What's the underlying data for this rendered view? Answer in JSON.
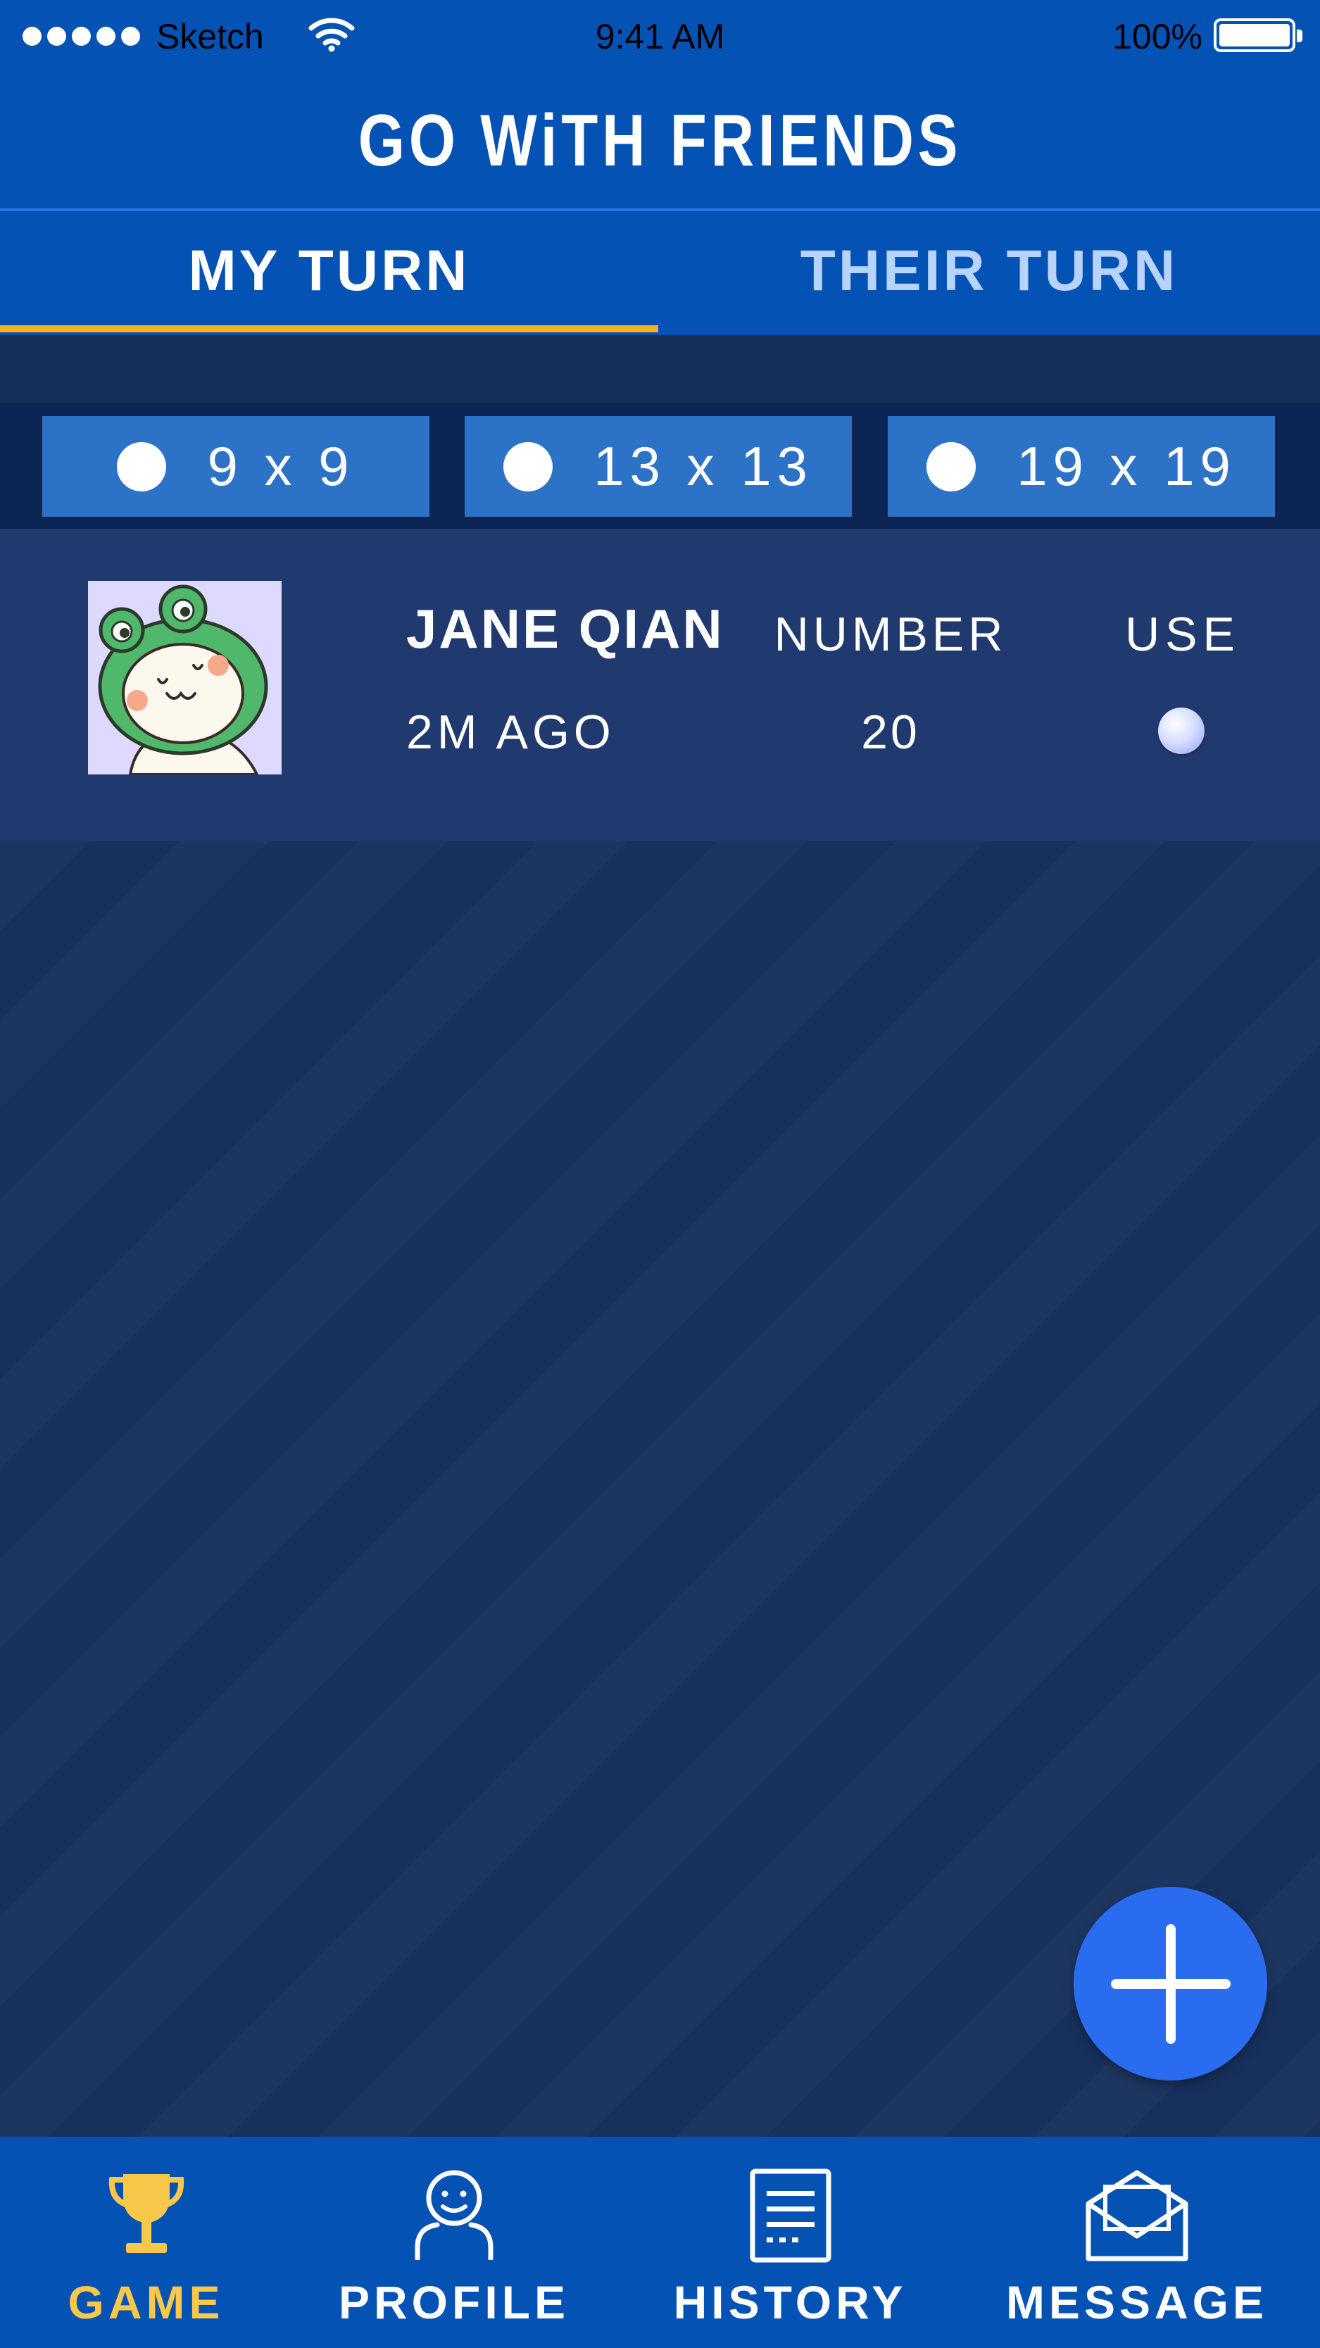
{
  "status_bar": {
    "carrier": "Sketch",
    "time": "9:41 AM",
    "battery": "100%"
  },
  "header": {
    "title": "GO WiTH FRIENDS"
  },
  "tabs": [
    {
      "label": "MY TURN",
      "active": true
    },
    {
      "label": "THEIR TURN",
      "active": false
    }
  ],
  "board_sizes": [
    {
      "label": "9 x 9"
    },
    {
      "label": "13 x 13"
    },
    {
      "label": "19 x 19"
    }
  ],
  "games": [
    {
      "player": "JANE QIAN",
      "last_played": "2M AGO",
      "number_label": "NUMBER",
      "number": "20",
      "use_label": "USE",
      "avatar_icon": "frog-avatar"
    }
  ],
  "fab": {
    "icon": "plus-icon"
  },
  "bottom_nav": [
    {
      "label": "GAME",
      "icon": "trophy-icon",
      "active": true
    },
    {
      "label": "PROFILE",
      "icon": "person-icon",
      "active": false
    },
    {
      "label": "HISTORY",
      "icon": "document-icon",
      "active": false
    },
    {
      "label": "MESSAGE",
      "icon": "envelope-icon",
      "active": false
    }
  ],
  "colors": {
    "primary_blue": "#0453b4",
    "background": "#17305c",
    "active_accent": "#f7b21b",
    "fab": "#2a6cf0"
  }
}
